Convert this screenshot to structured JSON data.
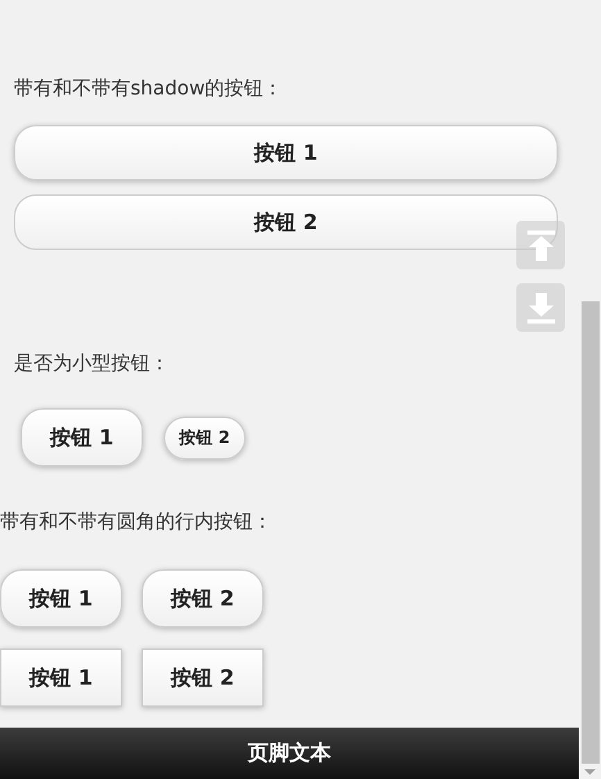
{
  "sections": [
    {
      "label": "带有和不带有shadow的按钮：",
      "inline": false,
      "rows": [
        [
          {
            "text": "按钮 1",
            "shadow": true,
            "mini": false,
            "rounded": true
          }
        ],
        [
          {
            "text": "按钮 2",
            "shadow": false,
            "mini": false,
            "rounded": true
          }
        ]
      ]
    },
    {
      "label": "是否为小型按钮：",
      "inline": true,
      "rows": [
        [
          {
            "text": "按钮 1",
            "shadow": true,
            "mini": false,
            "rounded": true
          },
          {
            "text": "按钮 2",
            "shadow": true,
            "mini": true,
            "rounded": true
          }
        ]
      ]
    },
    {
      "label": "带有和不带有圆角的行内按钮：",
      "inline": true,
      "rows": [
        [
          {
            "text": "按钮 1",
            "shadow": true,
            "mini": false,
            "rounded": true
          },
          {
            "text": "按钮 2",
            "shadow": true,
            "mini": false,
            "rounded": true
          }
        ],
        [
          {
            "text": "按钮 1",
            "shadow": true,
            "mini": false,
            "rounded": false
          },
          {
            "text": "按钮 2",
            "shadow": true,
            "mini": false,
            "rounded": false
          }
        ]
      ]
    }
  ],
  "footer": {
    "title": "页脚文本"
  }
}
